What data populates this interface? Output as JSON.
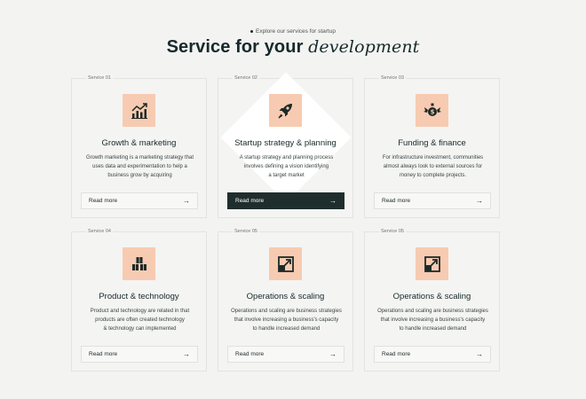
{
  "header": {
    "eyebrow": "Explore our services for startup",
    "title_main": "Service for your",
    "title_accent": "development"
  },
  "services": [
    {
      "label": "Service 01",
      "icon": "growth-chart-icon",
      "title": "Growth & marketing",
      "desc_lines": [
        "Growth marketing is a marketing strategy that",
        "uses data and experimentation to help a",
        "business grow by acquiring"
      ],
      "button": "Read more",
      "active": false
    },
    {
      "label": "Service 02",
      "icon": "rocket-icon",
      "title": "Startup strategy & planning",
      "desc_lines": [
        "A startup strategy and planning process",
        "involves defining a vision identifying",
        "a target market"
      ],
      "button": "Read more",
      "active": true
    },
    {
      "label": "Service 03",
      "icon": "funding-icon",
      "title": "Funding & finance",
      "desc_lines": [
        "For infrastructure investment, communities",
        "almost always look  to external sources for",
        "money to complete projects."
      ],
      "button": "Read more",
      "active": false
    },
    {
      "label": "Service 04",
      "icon": "blocks-icon",
      "title": "Product & technology",
      "desc_lines": [
        "Product and technology are related in that",
        "products are often created technology",
        "& technology can implemented"
      ],
      "button": "Read more",
      "active": false
    },
    {
      "label": "Service 05",
      "icon": "scale-arrow-icon",
      "title": "Operations & scaling",
      "desc_lines": [
        "Operations and scaling are business strategies",
        "that involve increasing a business's capacity",
        "to handle  increased demand"
      ],
      "button": "Read more",
      "active": false
    },
    {
      "label": "Service 05",
      "icon": "scale-arrow-icon",
      "title": "Operations & scaling",
      "desc_lines": [
        "Operations and scaling are business strategies",
        "that involve increasing a business's capacity",
        "to handle  increased demand"
      ],
      "button": "Read more",
      "active": false
    }
  ],
  "colors": {
    "icon_bg": "#f7cbb1",
    "dark_button": "#1f2e2c",
    "background": "#f3f3f2"
  }
}
